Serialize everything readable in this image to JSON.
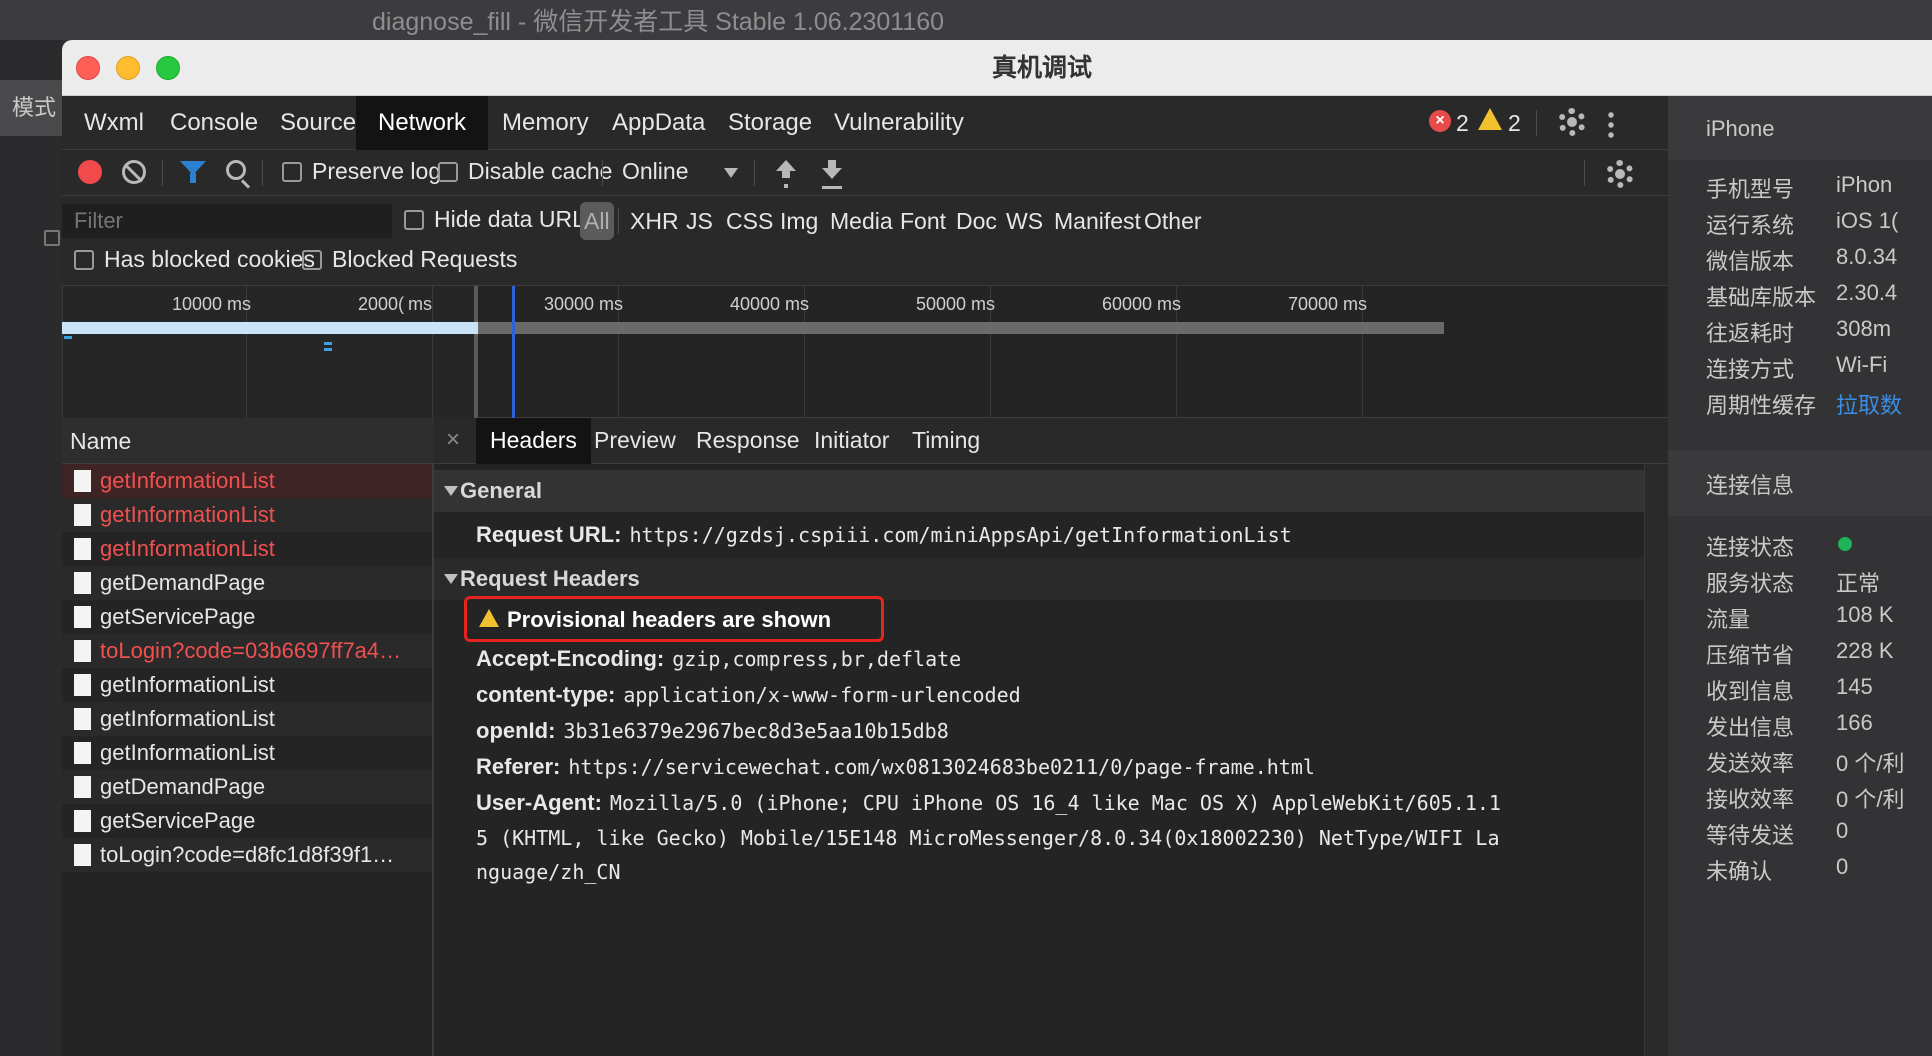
{
  "app": {
    "bg_title": "diagnose_fill  -  微信开发者工具 Stable 1.06.2301160",
    "bg_mode": "模式",
    "window_title": "真机调试"
  },
  "tabs": [
    "Wxml",
    "Console",
    "Sources",
    "Network",
    "Memory",
    "AppData",
    "Storage",
    "Vulnerability"
  ],
  "active_tab": "Network",
  "badges": {
    "errors": "2",
    "warnings": "2"
  },
  "toolbar": {
    "preserve_log": "Preserve log",
    "disable_cache": "Disable cache",
    "throttle": "Online"
  },
  "filter": {
    "placeholder": "Filter",
    "hide_data_urls": "Hide data URLs",
    "types": [
      "All",
      "XHR",
      "JS",
      "CSS",
      "Img",
      "Media",
      "Font",
      "Doc",
      "WS",
      "Manifest",
      "Other"
    ],
    "has_blocked_cookies": "Has blocked cookies",
    "blocked_requests": "Blocked Requests"
  },
  "overview": {
    "labels": [
      "10000 ms",
      "2000(",
      "ms",
      "30000 ms",
      "40000 ms",
      "50000 ms",
      "60000 ms",
      "70000 ms"
    ]
  },
  "name_list": {
    "header": "Name",
    "rows": [
      {
        "name": "getInformationList",
        "error": true
      },
      {
        "name": "getInformationList",
        "error": true
      },
      {
        "name": "getInformationList",
        "error": true
      },
      {
        "name": "getDemandPage",
        "error": false
      },
      {
        "name": "getServicePage",
        "error": false
      },
      {
        "name": "toLogin?code=03b6697ff7a4…",
        "error": true
      },
      {
        "name": "getInformationList",
        "error": false
      },
      {
        "name": "getInformationList",
        "error": false
      },
      {
        "name": "getInformationList",
        "error": false
      },
      {
        "name": "getDemandPage",
        "error": false
      },
      {
        "name": "getServicePage",
        "error": false
      },
      {
        "name": "toLogin?code=d8fc1d8f39f1…",
        "error": false
      }
    ]
  },
  "details": {
    "close": "×",
    "tabs": [
      "Headers",
      "Preview",
      "Response",
      "Initiator",
      "Timing"
    ],
    "active_tab": "Headers",
    "general_title": "General",
    "request_url_key": "Request URL:",
    "request_url": "https://gzdsj.cspiii.com/miniAppsApi/getInformationList",
    "request_headers_title": "Request Headers",
    "provisional": "Provisional headers are shown",
    "headers": [
      {
        "key": "Accept-Encoding:",
        "value": "gzip,compress,br,deflate"
      },
      {
        "key": "content-type:",
        "value": "application/x-www-form-urlencoded"
      },
      {
        "key": "openId:",
        "value": "3b31e6379e2967bec8d3e5aa10b15db8"
      },
      {
        "key": "Referer:",
        "value": "https://servicewechat.com/wx0813024683be0211/0/page-frame.html"
      },
      {
        "key": "User-Agent:",
        "value": "Mozilla/5.0 (iPhone; CPU iPhone OS 16_4 like Mac OS X) AppleWebKit/605.1.1"
      }
    ],
    "ua_line2": "5 (KHTML, like Gecko) Mobile/15E148 MicroMessenger/8.0.34(0x18002230) NetType/WIFI La",
    "ua_line3": "nguage/zh_CN"
  },
  "phone_panel": {
    "title": "iPhone",
    "info": [
      {
        "key": "手机型号",
        "value": "iPhon"
      },
      {
        "key": "运行系统",
        "value": "iOS 1("
      },
      {
        "key": "微信版本",
        "value": "8.0.34"
      },
      {
        "key": "基础库版本",
        "value": "2.30.4"
      },
      {
        "key": "往返耗时",
        "value": "308m"
      },
      {
        "key": "连接方式",
        "value": "Wi-Fi"
      },
      {
        "key": "周期性缓存",
        "value": "拉取数"
      }
    ],
    "conn_title": "连接信息",
    "conn": [
      {
        "key": "连接状态",
        "value": ""
      },
      {
        "key": "服务状态",
        "value": "正常"
      },
      {
        "key": "流量",
        "value": "108 K"
      },
      {
        "key": "压缩节省",
        "value": "228 K"
      },
      {
        "key": "收到信息",
        "value": "145"
      },
      {
        "key": "发出信息",
        "value": "166"
      },
      {
        "key": "发送效率",
        "value": "0 个/利"
      },
      {
        "key": "接收效率",
        "value": "0 个/利"
      },
      {
        "key": "等待发送",
        "value": "0"
      },
      {
        "key": "未确认",
        "value": "0"
      }
    ]
  },
  "colors": {
    "accent_blue": "#2c7fd1",
    "error_red": "#f05050",
    "status_green": "#20b35a"
  }
}
